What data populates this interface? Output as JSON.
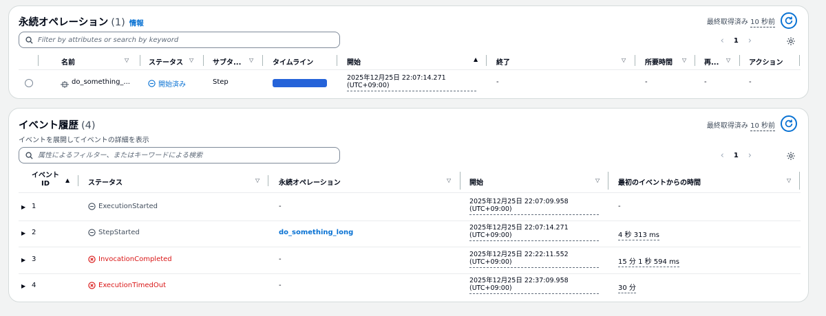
{
  "ops": {
    "title": "永続オペレーション",
    "count": "(1)",
    "info_link": "情報",
    "last_fetched_label": "最終取得済み",
    "last_fetched_ago": "10 秒前",
    "search_placeholder": "Filter by attributes or search by keyword",
    "page": "1",
    "columns": [
      "名前",
      "ステータス",
      "サブタ...",
      "タイムライン",
      "開始",
      "終了",
      "所要時間",
      "再...",
      "アクション"
    ],
    "row": {
      "name": "do_something_...",
      "status": "開始済み",
      "subtype": "Step",
      "start_line1": "2025年12月25日 22:07:14.271",
      "start_line2": "(UTC+09:00)",
      "end": "-",
      "duration": "-",
      "retry": "-",
      "action": "-"
    }
  },
  "events": {
    "title": "イベント履歴",
    "count": "(4)",
    "subtitle": "イベントを展開してイベントの詳細を表示",
    "last_fetched_label": "最終取得済み",
    "last_fetched_ago": "10 秒前",
    "search_placeholder": "属性によるフィルター、またはキーワードによる検索",
    "page": "1",
    "columns": {
      "id_line1": "イベント",
      "id_line2": "ID",
      "status": "ステータス",
      "operation": "永続オペレーション",
      "start": "開始",
      "elapsed": "最初のイベントからの時間"
    },
    "rows": [
      {
        "id": "1",
        "status": "ExecutionStarted",
        "operation": "-",
        "start_line1": "2025年12月25日 22:07:09.958",
        "start_line2": "(UTC+09:00)",
        "elapsed": "-"
      },
      {
        "id": "2",
        "status": "StepStarted",
        "operation": "do_something_long",
        "start_line1": "2025年12月25日 22:07:14.271",
        "start_line2": "(UTC+09:00)",
        "elapsed": "4 秒 313 ms"
      },
      {
        "id": "3",
        "status": "InvocationCompleted",
        "operation": "-",
        "start_line1": "2025年12月25日 22:22:11.552",
        "start_line2": "(UTC+09:00)",
        "elapsed": "15 分 1 秒 594 ms"
      },
      {
        "id": "4",
        "status": "ExecutionTimedOut",
        "operation": "-",
        "start_line1": "2025年12月25日 22:37:09.958",
        "start_line2": "(UTC+09:00)",
        "elapsed": "30 分"
      }
    ]
  },
  "colors": {
    "link": "#0972d3",
    "error": "#d91515",
    "timeline_bar": "#2563d9",
    "muted": "#414d5c"
  }
}
